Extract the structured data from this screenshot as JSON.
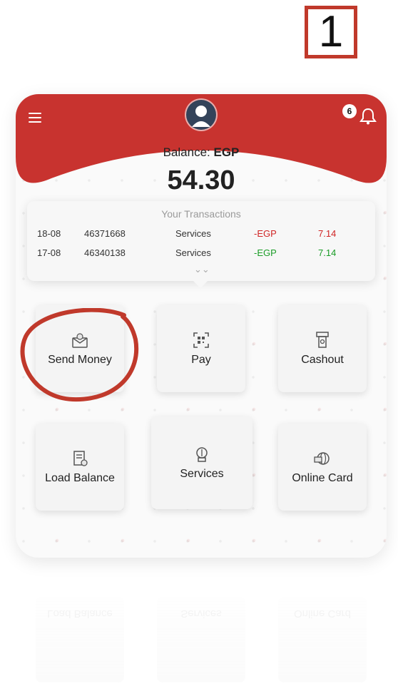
{
  "step_number": "1",
  "header": {
    "badge_count": "6",
    "balance_label": "Balance:",
    "balance_currency": "EGP",
    "balance_amount": "54.30",
    "brand_color": "#c8332f"
  },
  "transactions": {
    "title": "Your Transactions",
    "rows": [
      {
        "date": "18-08",
        "id": "46371668",
        "type": "Services",
        "currency": "-EGP",
        "amount": "7.14",
        "status_color": "red"
      },
      {
        "date": "17-08",
        "id": "46340138",
        "type": "Services",
        "currency": "-EGP",
        "amount": "7.14",
        "status_color": "green"
      }
    ],
    "expand_icon": "chevron-double-down-icon"
  },
  "actions": [
    {
      "label": "Send Money",
      "icon": "send-money-icon"
    },
    {
      "label": "Pay",
      "icon": "qr-scan-icon"
    },
    {
      "label": "Cashout",
      "icon": "atm-cash-icon"
    },
    {
      "label": "Load Balance",
      "icon": "load-balance-icon"
    },
    {
      "label": "Services",
      "icon": "services-icon"
    },
    {
      "label": "Online Card",
      "icon": "online-card-icon"
    }
  ],
  "annotation": {
    "circle_color": "#c0392b"
  }
}
